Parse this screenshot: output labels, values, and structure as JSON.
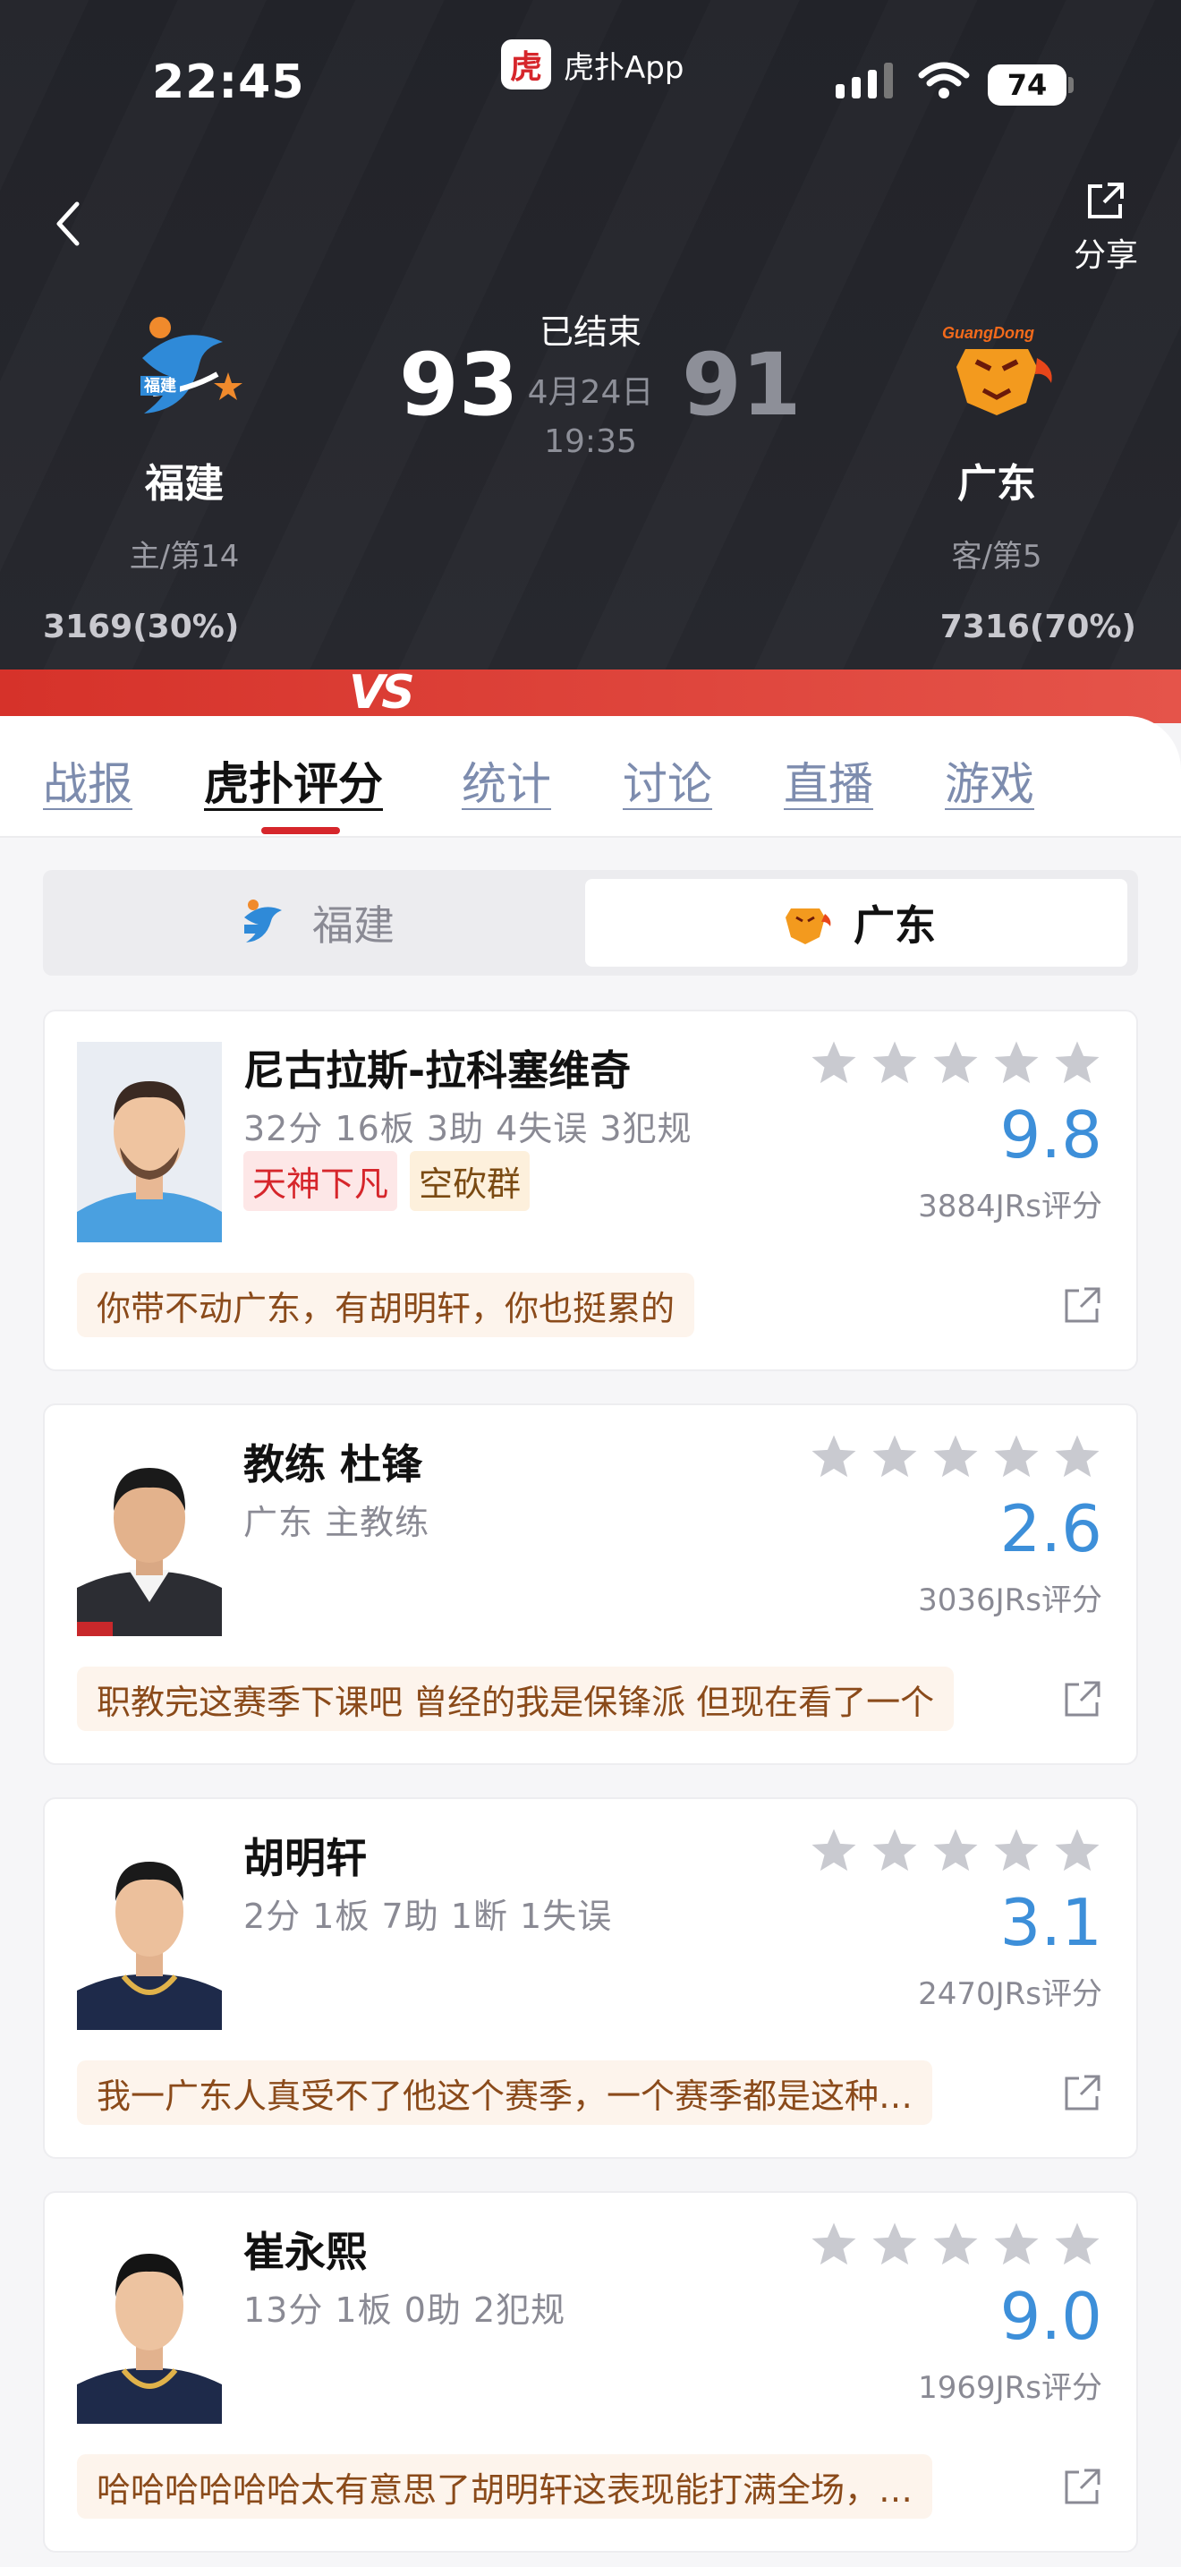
{
  "status_bar": {
    "time": "22:45",
    "app_name": "虎扑App",
    "app_logo_text": "虎扑",
    "battery": "74"
  },
  "header": {
    "share_label": "分享",
    "match_status": "已结束",
    "match_date": "4月24日",
    "match_time": "19:35",
    "home": {
      "name": "福建",
      "rank": "主/第14",
      "score": "93",
      "support": "3169(30%)"
    },
    "away": {
      "name": "广东",
      "rank": "客/第5",
      "score": "91",
      "support": "7316(70%)"
    },
    "vs": "VS"
  },
  "tabs": [
    {
      "label": "战报"
    },
    {
      "label": "虎扑评分"
    },
    {
      "label": "统计"
    },
    {
      "label": "讨论"
    },
    {
      "label": "直播"
    },
    {
      "label": "游戏"
    }
  ],
  "active_tab": "虎扑评分",
  "team_switch": {
    "home": "福建",
    "away": "广东",
    "selected": "广东"
  },
  "accent_colors": {
    "red": "#d6262b",
    "score_blue": "#3d8fd9"
  },
  "players": [
    {
      "name": "尼古拉斯-拉科塞维奇",
      "stats": "32分 16板 3助 4失误 3犯规",
      "tags": [
        "天神下凡",
        "空砍群"
      ],
      "rating": "9.8",
      "raters": "3884JRs评分",
      "comment": "你带不动广东，有胡明轩，你也挺累的"
    },
    {
      "name": "教练 杜锋",
      "stats": "广东 主教练",
      "tags": [],
      "rating": "2.6",
      "raters": "3036JRs评分",
      "comment": "职教完这赛季下课吧 曾经的我是保锋派 但现在看了一个"
    },
    {
      "name": "胡明轩",
      "stats": "2分 1板 7助 1断 1失误",
      "tags": [],
      "rating": "3.1",
      "raters": "2470JRs评分",
      "comment": "我一广东人真受不了他这个赛季，一个赛季都是这种…"
    },
    {
      "name": "崔永熙",
      "stats": "13分 1板 0助 2犯规",
      "tags": [],
      "rating": "9.0",
      "raters": "1969JRs评分",
      "comment": "哈哈哈哈哈哈太有意思了胡明轩这表现能打满全场，…"
    }
  ]
}
